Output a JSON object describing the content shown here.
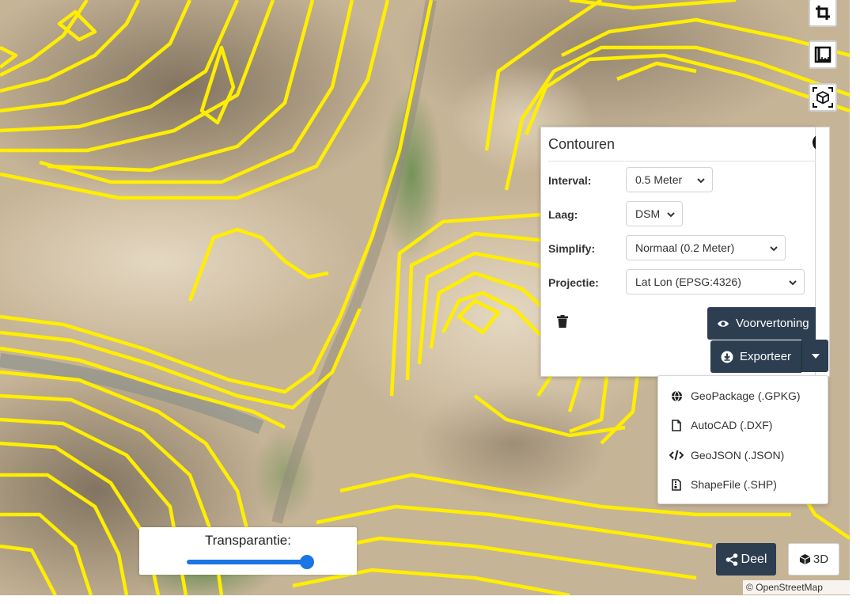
{
  "panel": {
    "title": "Contouren",
    "rows": [
      {
        "label": "Interval:",
        "value": "0.5 Meter"
      },
      {
        "label": "Laag:",
        "value": "DSM"
      },
      {
        "label": "Simplify:",
        "value": "Normaal (0.2 Meter)"
      },
      {
        "label": "Projectie:",
        "value": "Lat Lon (EPSG:4326)"
      }
    ],
    "preview_label": "Voorvertoning",
    "export_label": "Exporteer"
  },
  "export_menu": {
    "items": [
      {
        "label": "GeoPackage (.GPKG)",
        "icon": "globe-icon"
      },
      {
        "label": "AutoCAD (.DXF)",
        "icon": "file-icon"
      },
      {
        "label": "GeoJSON (.JSON)",
        "icon": "code-icon"
      },
      {
        "label": "ShapeFile (.SHP)",
        "icon": "file-archive-icon"
      }
    ]
  },
  "transparency": {
    "label": "Transparantie:",
    "value": 1.0
  },
  "share_label": "Deel",
  "view3d_label": "3D",
  "attribution": {
    "symbol": "©",
    "link": "OpenStreetMap"
  },
  "colors": {
    "contour": "#ffee00",
    "accent": "#2c3e50",
    "slider": "#1b75e6"
  }
}
